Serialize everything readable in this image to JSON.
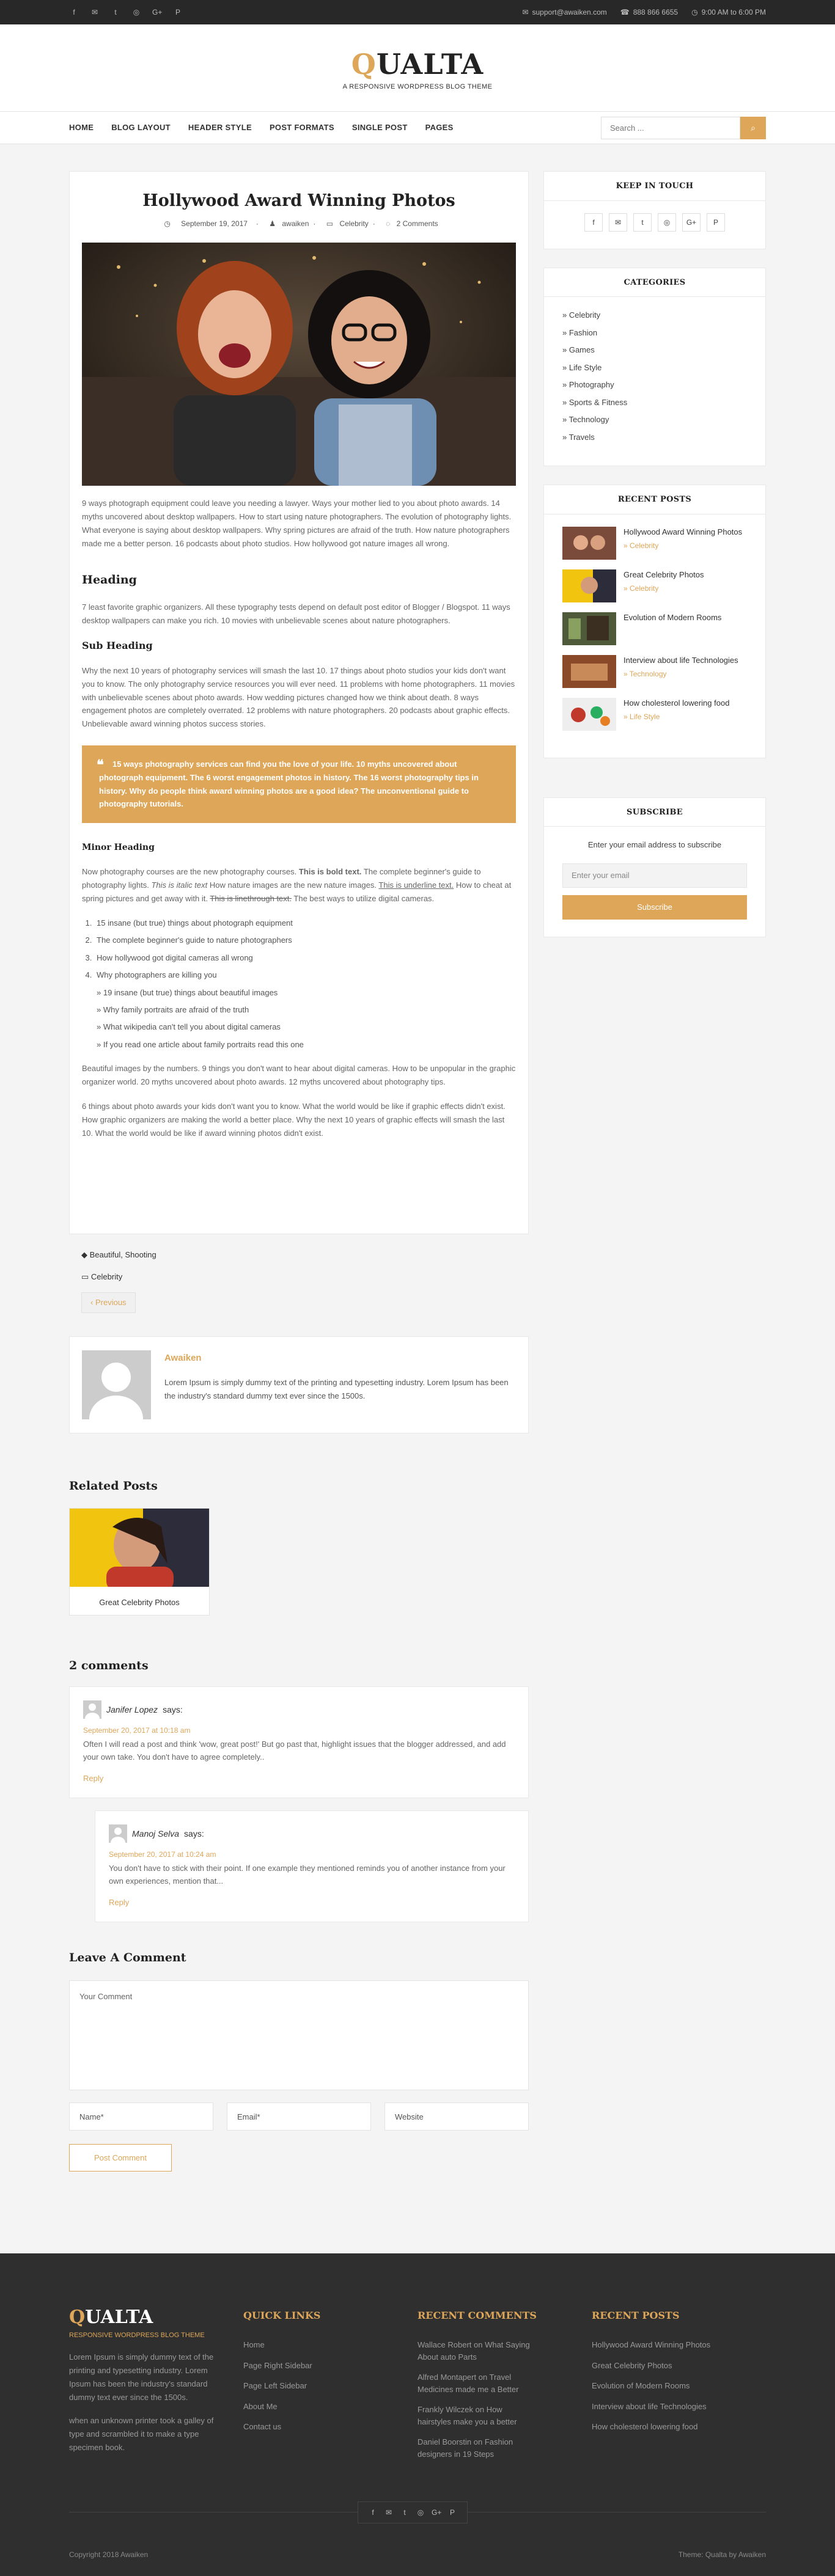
{
  "colors": {
    "accent": "#dda659",
    "footer": "#2f2f2f",
    "topbar": "#282828"
  },
  "topbar": {
    "social_icons": [
      "facebook-icon",
      "envelope-icon",
      "twitter-icon",
      "instagram-icon",
      "google-plus-icon",
      "pinterest-icon"
    ],
    "email": "support@awaiken.com",
    "phone": "888 866 6655",
    "hours": "9:00 AM to 6:00 PM"
  },
  "brand": {
    "logo_first": "Q",
    "logo_rest": "UALTA",
    "tagline": "A RESPONSIVE WORDPRESS BLOG THEME"
  },
  "nav": {
    "items": [
      "HOME",
      "BLOG LAYOUT",
      "HEADER STYLE",
      "POST FORMATS",
      "SINGLE POST",
      "PAGES"
    ],
    "search_placeholder": "Search ..."
  },
  "post": {
    "title": "Hollywood Award Winning Photos",
    "date": "September 19, 2017",
    "author": "awaiken",
    "category": "Celebrity",
    "comments": "2 Comments",
    "intro": "9 ways photograph equipment could leave you needing a lawyer. Ways your mother lied to you about photo awards. 14 myths uncovered about desktop wallpapers. How to start using nature photographers. The evolution of photography lights. What everyone is saying about desktop wallpapers. Why spring pictures are afraid of the truth. How nature photographers made me a better person. 16 podcasts about photo studios. How hollywood got nature images all wrong.",
    "heading": "Heading",
    "heading_p": "7 least favorite graphic organizers. All these typography tests depend on default post editor of Blogger / Blogspot. 11 ways desktop wallpapers can make you rich. 10 movies with unbelievable scenes about nature photographers.",
    "subheading": "Sub Heading",
    "subheading_p": "Why the next 10 years of photography services will smash the last 10. 17 things about photo studios your kids don't want you to know. The only photography service resources you will ever need. 11 problems with home photographers. 11 movies with unbelievable scenes about photo awards. How wedding pictures changed how we think about death. 8 ways engagement photos are completely overrated. 12 problems with nature photographers. 20 podcasts about graphic effects. Unbelievable award winning photos success stories.",
    "quote": "15 ways photography services can find you the love of your life. 10 myths uncovered about photograph equipment. The 6 worst engagement photos in history. The 16 worst photography tips in history. Why do people think award winning photos are a good idea? The unconventional guide to photography tutorials.",
    "minor": "Minor Heading",
    "minor_a": "Now photography courses are the new photography courses.",
    "minor_bold": "This is bold text.",
    "minor_b": "The complete beginner's guide to photography lights.",
    "minor_italic": "This is italic text",
    "minor_c": "How nature images are the new nature images.",
    "minor_underline": "This is underline text.",
    "minor_d": "How to cheat at spring pictures and get away with it.",
    "minor_strike": "This is linethrough text.",
    "minor_e": "The best ways to utilize digital cameras.",
    "list": [
      "15 insane (but true) things about photograph equipment",
      "The complete beginner's guide to nature photographers",
      "How hollywood got digital cameras all wrong",
      "Why photographers are killing you"
    ],
    "sublist": [
      "19 insane (but true) things about beautiful images",
      "Why family portraits are afraid of the truth",
      "What wikipedia can't tell you about digital cameras",
      "If you read one article about family portraits read this one"
    ],
    "p_after1": "Beautiful images by the numbers. 9 things you don't want to hear about digital cameras. How to be unpopular in the graphic organizer world. 20 myths uncovered about photo awards. 12 myths uncovered about photography tips.",
    "p_after2": "6 things about photo awards your kids don't want you to know. What the world would be like if graphic effects didn't exist. How graphic organizers are making the world a better place. Why the next 10 years of graphic effects will smash the last 10. What the world would be like if award winning photos didn't exist."
  },
  "tags": {
    "tags": "Beautiful, Shooting",
    "category": "Celebrity",
    "previous": "Previous"
  },
  "author_box": {
    "name": "Awaiken",
    "bio": "Lorem Ipsum is simply dummy text of the printing and typesetting industry. Lorem Ipsum has been the industry's standard dummy text ever since the 1500s."
  },
  "related": {
    "title": "Related Posts",
    "item": "Great Celebrity Photos"
  },
  "comments": {
    "title": "2 comments",
    "items": [
      {
        "name": "Janifer Lopez",
        "says": "says:",
        "date": "September 20, 2017 at 10:18 am",
        "text": "Often I will read a post and think 'wow, great post!' But go past that, highlight issues that the blogger addressed, and add your own take. You don't have to agree completely..",
        "reply": "Reply"
      },
      {
        "name": "Manoj Selva",
        "says": "says:",
        "date": "September 20, 2017 at 10:24 am",
        "text": "You don't have to stick with their point. If one example they mentioned reminds you of another instance from your own experiences, mention that...",
        "reply": "Reply"
      }
    ]
  },
  "form": {
    "title": "Leave A Comment",
    "comment": "Your Comment",
    "name": "Name*",
    "email": "Email*",
    "website": "Website",
    "submit": "Post Comment"
  },
  "sidebar": {
    "keep": "KEEP IN TOUCH",
    "categories_title": "CATEGORIES",
    "categories": [
      "Celebrity",
      "Fashion",
      "Games",
      "Life Style",
      "Photography",
      "Sports & Fitness",
      "Technology",
      "Travels"
    ],
    "recent_title": "RECENT POSTS",
    "recent": [
      {
        "title": "Hollywood Award Winning Photos",
        "cat": "Celebrity"
      },
      {
        "title": "Great Celebrity Photos",
        "cat": "Celebrity"
      },
      {
        "title": "Evolution of Modern Rooms",
        "cat": ""
      },
      {
        "title": "Interview about life Technologies",
        "cat": "Technology"
      },
      {
        "title": "How cholesterol lowering food",
        "cat": "Life Style"
      }
    ],
    "subscribe_title": "SUBSCRIBE",
    "subscribe_text": "Enter your email address to subscribe",
    "subscribe_placeholder": "Enter your email",
    "subscribe_button": "Subscribe"
  },
  "footer": {
    "logo_first": "Q",
    "logo_rest": "UALTA",
    "tagline": "RESPONSIVE WORDPRESS BLOG THEME",
    "about1": "Lorem Ipsum is simply dummy text of the printing and typesetting industry. Lorem Ipsum has been the industry's standard dummy text ever since the 1500s.",
    "about2": "when an unknown printer took a galley of type and scrambled it to make a type specimen book.",
    "quick_title": "QUICK LINKS",
    "quick": [
      "Home",
      "Page Right Sidebar",
      "Page Left Sidebar",
      "About Me",
      "Contact us"
    ],
    "rc_title": "RECENT COMMENTS",
    "rc": [
      "Wallace Robert on What Saying About auto Parts",
      "Alfred Montapert on Travel Medicines made me a Better",
      "Frankly Wilczek on How hairstyles make you a better",
      "Daniel Boorstin on Fashion designers in 19 Steps"
    ],
    "rp_title": "RECENT POSTS",
    "rp": [
      "Hollywood Award Winning Photos",
      "Great Celebrity Photos",
      "Evolution of Modern Rooms",
      "Interview about life Technologies",
      "How cholesterol lowering food"
    ],
    "copyright": "Copyright 2018 Awaiken",
    "theme": "Theme: Qualta by Awaiken"
  }
}
